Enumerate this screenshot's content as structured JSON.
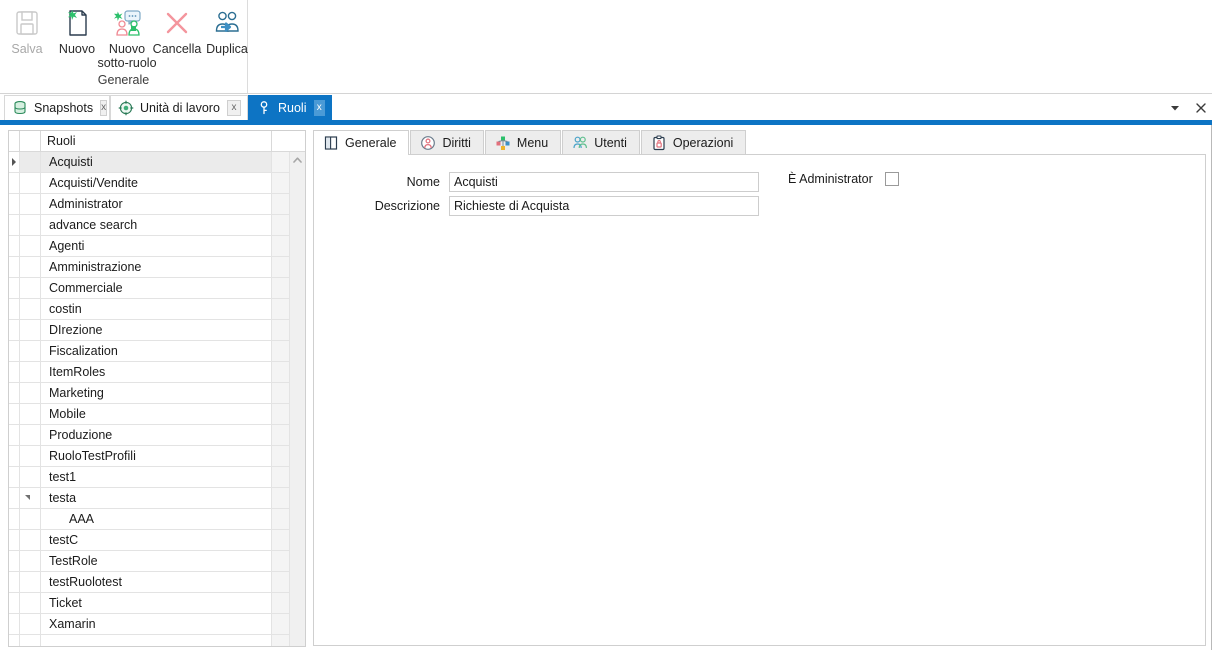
{
  "ribbon": {
    "group_label": "Generale",
    "buttons": [
      {
        "label": "Salva",
        "icon": "save-icon",
        "disabled": true
      },
      {
        "label": "Nuovo",
        "icon": "new-document-icon",
        "disabled": false
      },
      {
        "label": "Nuovo sotto-ruolo",
        "icon": "new-subrole-icon",
        "disabled": false
      },
      {
        "label": "Cancella",
        "icon": "delete-x-icon",
        "disabled": false
      },
      {
        "label": "Duplica",
        "icon": "duplicate-users-icon",
        "disabled": false
      }
    ]
  },
  "document_tabs": {
    "close_label": "x",
    "items": [
      {
        "label": "Snapshots",
        "icon": "database-icon",
        "active": false
      },
      {
        "label": "Unità di lavoro",
        "icon": "workunit-icon",
        "active": false
      },
      {
        "label": "Ruoli",
        "icon": "key-icon",
        "active": true
      }
    ],
    "controls": [
      {
        "name": "tab-list-dropdown",
        "icon": "chevron-down-icon"
      },
      {
        "name": "close-tab-button",
        "icon": "close-icon"
      }
    ]
  },
  "grid": {
    "header": "Ruoli",
    "rows": [
      {
        "label": "Acquisti",
        "selected": true,
        "indicator": true,
        "level": 0,
        "expander": false
      },
      {
        "label": "Acquisti/Vendite",
        "selected": false,
        "indicator": false,
        "level": 0,
        "expander": false
      },
      {
        "label": "Administrator",
        "selected": false,
        "indicator": false,
        "level": 0,
        "expander": false
      },
      {
        "label": "advance search",
        "selected": false,
        "indicator": false,
        "level": 0,
        "expander": false
      },
      {
        "label": "Agenti",
        "selected": false,
        "indicator": false,
        "level": 0,
        "expander": false
      },
      {
        "label": "Amministrazione",
        "selected": false,
        "indicator": false,
        "level": 0,
        "expander": false
      },
      {
        "label": "Commerciale",
        "selected": false,
        "indicator": false,
        "level": 0,
        "expander": false
      },
      {
        "label": "costin",
        "selected": false,
        "indicator": false,
        "level": 0,
        "expander": false
      },
      {
        "label": "DIrezione",
        "selected": false,
        "indicator": false,
        "level": 0,
        "expander": false
      },
      {
        "label": "Fiscalization",
        "selected": false,
        "indicator": false,
        "level": 0,
        "expander": false
      },
      {
        "label": "ItemRoles",
        "selected": false,
        "indicator": false,
        "level": 0,
        "expander": false
      },
      {
        "label": "Marketing",
        "selected": false,
        "indicator": false,
        "level": 0,
        "expander": false
      },
      {
        "label": "Mobile",
        "selected": false,
        "indicator": false,
        "level": 0,
        "expander": false
      },
      {
        "label": "Produzione",
        "selected": false,
        "indicator": false,
        "level": 0,
        "expander": false
      },
      {
        "label": "RuoloTestProfili",
        "selected": false,
        "indicator": false,
        "level": 0,
        "expander": false
      },
      {
        "label": "test1",
        "selected": false,
        "indicator": false,
        "level": 0,
        "expander": false
      },
      {
        "label": "testa",
        "selected": false,
        "indicator": false,
        "level": 0,
        "expander": true
      },
      {
        "label": "AAA",
        "selected": false,
        "indicator": false,
        "level": 1,
        "expander": false
      },
      {
        "label": "testC",
        "selected": false,
        "indicator": false,
        "level": 0,
        "expander": false
      },
      {
        "label": "TestRole",
        "selected": false,
        "indicator": false,
        "level": 0,
        "expander": false
      },
      {
        "label": "testRuolotest",
        "selected": false,
        "indicator": false,
        "level": 0,
        "expander": false
      },
      {
        "label": "Ticket",
        "selected": false,
        "indicator": false,
        "level": 0,
        "expander": false
      },
      {
        "label": "Xamarin",
        "selected": false,
        "indicator": false,
        "level": 0,
        "expander": false
      }
    ]
  },
  "detail": {
    "tabs": [
      {
        "label": "Generale",
        "icon": "book-icon",
        "active": true
      },
      {
        "label": "Diritti",
        "icon": "rights-person-icon",
        "active": false
      },
      {
        "label": "Menu",
        "icon": "menu-tree-icon",
        "active": false
      },
      {
        "label": "Utenti",
        "icon": "users-icon",
        "active": false
      },
      {
        "label": "Operazioni",
        "icon": "clipboard-lock-icon",
        "active": false
      }
    ],
    "form": {
      "nome_label": "Nome",
      "nome_value": "Acquisti",
      "descrizione_label": "Descrizione",
      "descrizione_value": "Richieste di Acquista",
      "admin_label": "È Administrator",
      "admin_checked": false
    }
  },
  "colors": {
    "accent": "#0d74c4",
    "tab_active_close": "#4a9ad6",
    "border": "#cfcfcf",
    "row_selected": "#ebebeb"
  }
}
